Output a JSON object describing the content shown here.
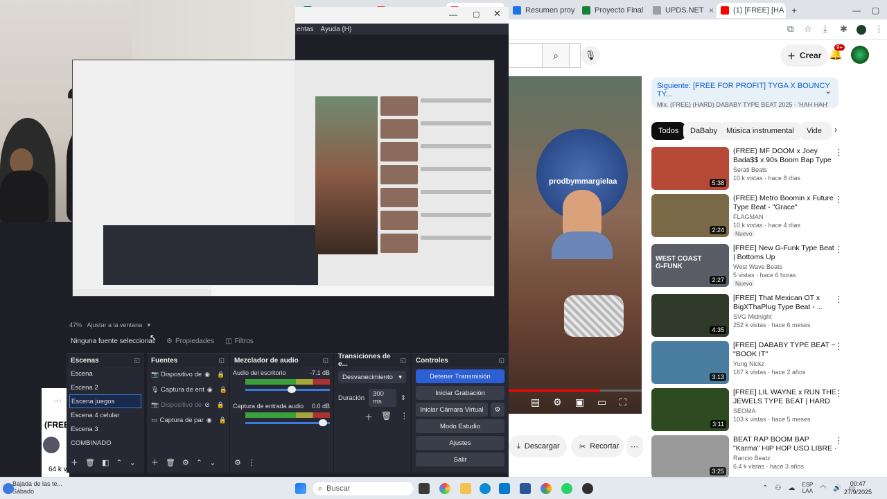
{
  "browser": {
    "tabs": [
      {
        "label": "Resumen proy",
        "color": "#1a73e8"
      },
      {
        "label": "Proyecto Final",
        "color": "#188038"
      },
      {
        "label": "UPDS.NET",
        "color": "#5f6368"
      },
      {
        "label": "(1) [FREE] [HA",
        "color": "#ff0000",
        "active": true
      }
    ],
    "new_tab": "+"
  },
  "youtube": {
    "create_label": "Crear",
    "notif_count": "9+",
    "channel_watermark": "prodbymmargielaa",
    "title_partial": "(FREE",
    "views_partial": "64 k v",
    "actions": {
      "download": "Descargar",
      "clip": "Recortar"
    },
    "up_next": {
      "title": "Siguiente: [FREE FOR PROFIT] TYGA X BOUNCY TY...",
      "subtitle": "Mix. (FREE) (HARD) DABABY TYPE BEAT 2025 - 'HAH HAH'"
    },
    "chips": [
      "Todos",
      "DaBaby",
      "Música instrumental",
      "Vide"
    ],
    "videos": [
      {
        "title": "(FREE) MF DOOM x Joey Bada$$ x 90s Boom Bap Type ...",
        "channel": "Serati Beats",
        "meta": "10 k vistas · hace 8 días",
        "duration": "5:38",
        "badge": "",
        "thumb": "#b64a36"
      },
      {
        "title": "(FREE) Metro Boomin x Future Type Beat - \"Grace\"",
        "channel": "FLAGMAN",
        "meta": "10 k vistas · hace 4 días",
        "duration": "2:24",
        "badge": "Nuevo",
        "thumb": "#7a6a48"
      },
      {
        "title": "[FREE] New G-Funk Type Beat | Bottoms Up",
        "channel": "West Wave Beats",
        "meta": "5 vistas · hace 6 horas",
        "duration": "2:27",
        "badge": "Nuevo",
        "thumb": "#5a5c66",
        "overlay": "WEST COAST G-FUNK"
      },
      {
        "title": "[FREE] That Mexican OT x BigXThaPlug Type Beat - ...",
        "channel": "SVG Midnight",
        "meta": "252 k vistas · hace 6 meses",
        "duration": "4:35",
        "badge": "",
        "thumb": "#2f3a2a"
      },
      {
        "title": "[FREE] DABABY TYPE BEAT ~ \"BOOK IT\"",
        "channel": "Yung Nickz",
        "meta": "167 k vistas · hace 2 años",
        "duration": "3:13",
        "badge": "",
        "thumb": "#4a7ea0"
      },
      {
        "title": "[FREE] LIL WAYNE x RUN THE JEWELS TYPE BEAT | HARD 8...",
        "channel": "SEOMA",
        "meta": "103 k vistas · hace 5 meses",
        "duration": "3:11",
        "badge": "",
        "thumb": "#2d4a20"
      },
      {
        "title": "BEAT RAP BOOM BAP \"Karma\" HIP HOP USO LIBRE · [Prod. ...",
        "channel": "Rancio Beatz",
        "meta": "6.4 k vistas · hace 3 años",
        "duration": "3:25",
        "badge": "",
        "thumb": "#9a9a9a"
      }
    ]
  },
  "obs": {
    "menu": [
      "entas",
      "Ayuda (H)"
    ],
    "zoom": "47%",
    "zoom_mode": "Ajustar a la ventana",
    "no_source": "Ninguna fuente seleccionada",
    "props_label": "Propiedades",
    "filters_label": "Filtros",
    "docks": {
      "scenes": "Escenas",
      "sources": "Fuentes",
      "mixer": "Mezclador de audio",
      "transitions": "Transiciones de e...",
      "controls": "Controles"
    },
    "scenes": [
      "Escena",
      "Escena 2",
      "Escena juegos",
      "Escena 4 celular",
      "Escena 3",
      "COMBINADO"
    ],
    "selected_scene": 2,
    "sources": [
      {
        "label": "Dispositivo de",
        "icon": "camera-icon",
        "dim": false
      },
      {
        "label": "Captura de ent",
        "icon": "microphone-icon",
        "dim": false
      },
      {
        "label": "Dispositivo de",
        "icon": "camera-icon",
        "dim": true
      },
      {
        "label": "Captura de par",
        "icon": "monitor-icon",
        "dim": false
      }
    ],
    "mixer": [
      {
        "name": "Audio del escritorio",
        "db": "-7.1 dB",
        "level": 0.58
      },
      {
        "name": "Captura de entrada audio",
        "db": "0.0 dB",
        "level": 1.0
      }
    ],
    "transition": "Desvanecimiento",
    "duration_label": "Duración",
    "duration_value": "300 ms",
    "controls": {
      "stop_stream": "Detener Transmisión",
      "start_rec": "Iniciar Grabación",
      "virtual_cam": "Iniciar Cámara Virtual",
      "studio_mode": "Modo Estudio",
      "settings": "Ajustes",
      "exit": "Salir"
    }
  },
  "taskbar": {
    "weather_line1": "Bajada de las te...",
    "weather_line2": "Sábado",
    "search_placeholder": "Buscar",
    "lang1": "ESP",
    "lang2": "LAA",
    "time": "00:47",
    "date": "27/9/2025"
  }
}
